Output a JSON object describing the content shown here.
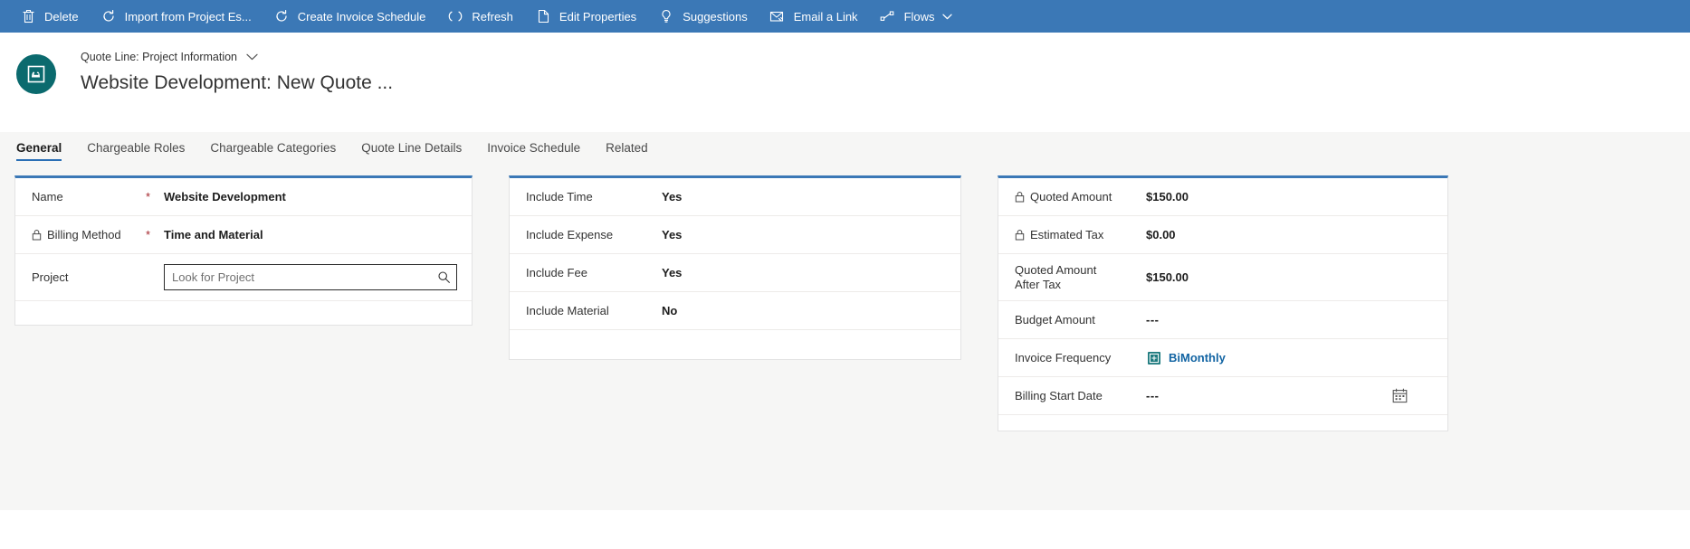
{
  "command_bar": {
    "background": "#3b78b6",
    "items": [
      {
        "label": "Delete",
        "icon": "trash-icon",
        "has_chevron": false
      },
      {
        "label": "Import from Project Es...",
        "icon": "refresh-circle-icon",
        "has_chevron": false
      },
      {
        "label": "Create Invoice Schedule",
        "icon": "refresh-circle-icon",
        "has_chevron": false
      },
      {
        "label": "Refresh",
        "icon": "refresh-icon",
        "has_chevron": false
      },
      {
        "label": "Edit Properties",
        "icon": "page-edit-icon",
        "has_chevron": false
      },
      {
        "label": "Suggestions",
        "icon": "lightbulb-icon",
        "has_chevron": false
      },
      {
        "label": "Email a Link",
        "icon": "email-link-icon",
        "has_chevron": false
      },
      {
        "label": "Flows",
        "icon": "flows-icon",
        "has_chevron": true
      }
    ]
  },
  "record_header": {
    "entity_label": "Quote Line: Project Information",
    "title": "Website Development: New Quote ...",
    "avatar_color": "#0b6a6e",
    "avatar_icon": "quote-line-icon",
    "chevron_icon": "chevron-down-icon"
  },
  "tabs": {
    "active_index": 0,
    "items": [
      {
        "label": "General"
      },
      {
        "label": "Chargeable Roles"
      },
      {
        "label": "Chargeable Categories"
      },
      {
        "label": "Quote Line Details"
      },
      {
        "label": "Invoice Schedule"
      },
      {
        "label": "Related"
      }
    ]
  },
  "accent_color": "#3b78b6",
  "required_color": "#a4262c",
  "link_color": "#1264a3",
  "column_one": {
    "fields": [
      {
        "label": "Name",
        "required": "*",
        "value": "Website Development",
        "locked": false,
        "type": "text"
      },
      {
        "label": "Billing Method",
        "required": "*",
        "value": "Time and Material",
        "locked": true,
        "type": "text"
      },
      {
        "label": "Project",
        "required": "",
        "value": "",
        "placeholder": "Look for Project",
        "locked": false,
        "type": "lookup",
        "search_icon": "search-icon"
      }
    ]
  },
  "column_two": {
    "fields": [
      {
        "label": "Include Time",
        "value": "Yes"
      },
      {
        "label": "Include Expense",
        "value": "Yes"
      },
      {
        "label": "Include Fee",
        "value": "Yes"
      },
      {
        "label": "Include Material",
        "value": "No"
      }
    ]
  },
  "column_three": {
    "fields": [
      {
        "label": "Quoted Amount",
        "value": "$150.00",
        "locked": true,
        "type": "text"
      },
      {
        "label": "Estimated Tax",
        "value": "$0.00",
        "locked": true,
        "type": "text"
      },
      {
        "label": "Quoted Amount After Tax",
        "label_line1": "Quoted Amount",
        "label_line2": "After Tax",
        "value": "$150.00",
        "locked": false,
        "type": "text"
      },
      {
        "label": "Budget Amount",
        "value": "---",
        "locked": false,
        "type": "text"
      },
      {
        "label": "Invoice Frequency",
        "value": "BiMonthly",
        "locked": false,
        "type": "link",
        "icon": "invoice-frequency-icon"
      },
      {
        "label": "Billing Start Date",
        "value": "---",
        "locked": false,
        "type": "date",
        "icon": "calendar-icon"
      }
    ]
  }
}
